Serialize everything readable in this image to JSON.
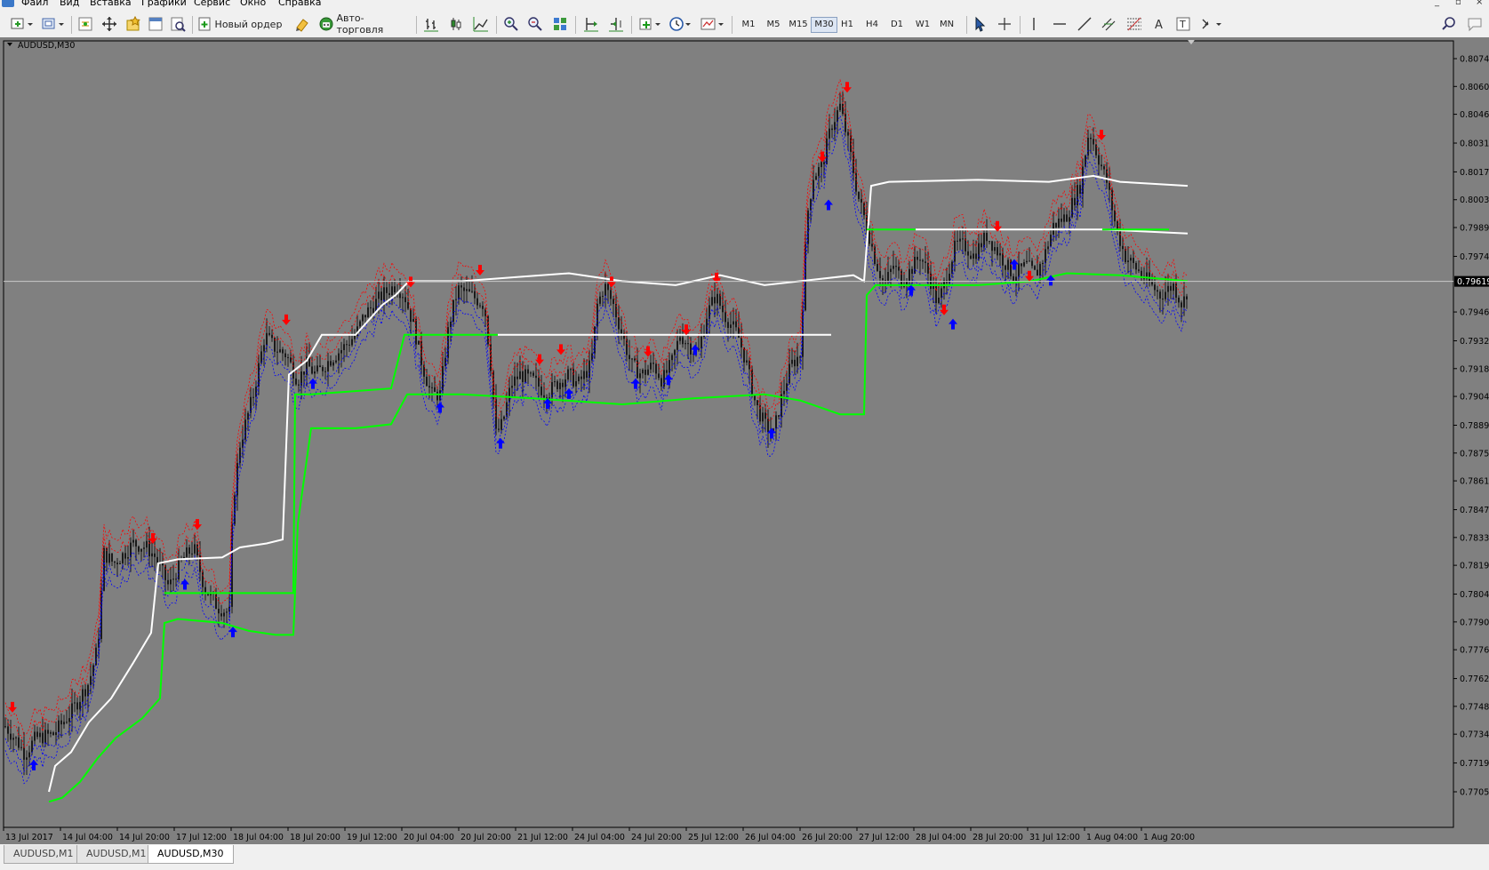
{
  "menu": [
    "Файл",
    "Вид",
    "Вставка",
    "Графики",
    "Сервис",
    "Окно",
    "Справка"
  ],
  "toolbar": {
    "new_order_label": "Новый ордер",
    "auto_trading_label": "Авто-торговля",
    "timeframes": [
      "M1",
      "M5",
      "M15",
      "M30",
      "H1",
      "H4",
      "D1",
      "W1",
      "MN"
    ],
    "active_timeframe": "M30"
  },
  "chart": {
    "symbol_label": "AUDUSD,M30",
    "current_price_label": "0.79619",
    "price_axis_labels": [
      "0.80740",
      "0.80600",
      "0.80460",
      "0.80315",
      "0.80170",
      "0.80030",
      "0.79890",
      "0.79745",
      "0.79465",
      "0.79320",
      "0.79180",
      "0.79040",
      "0.78895",
      "0.78755",
      "0.78615",
      "0.78470",
      "0.78330",
      "0.78190",
      "0.78045",
      "0.77905",
      "0.77765",
      "0.77620",
      "0.77480",
      "0.77340",
      "0.77195",
      "0.77050"
    ],
    "time_axis_labels": [
      "13 Jul 2017",
      "14 Jul 04:00",
      "14 Jul 20:00",
      "17 Jul 12:00",
      "18 Jul 04:00",
      "18 Jul 20:00",
      "19 Jul 12:00",
      "20 Jul 04:00",
      "20 Jul 20:00",
      "21 Jul 12:00",
      "24 Jul 04:00",
      "24 Jul 20:00",
      "25 Jul 12:00",
      "26 Jul 04:00",
      "26 Jul 20:00",
      "27 Jul 12:00",
      "28 Jul 04:00",
      "28 Jul 20:00",
      "31 Jul 12:00",
      "1 Aug 04:00",
      "1 Aug 20:00"
    ],
    "colors": {
      "background": "#808080",
      "candles": "#1a1a1a",
      "white_line": "#ffffff",
      "green_line": "#00ff00",
      "red_band": "#ff0000",
      "blue_band": "#0000ff",
      "arrow_down": "#ff0000",
      "arrow_up": "#0000ff",
      "price_line": "#c8c8c8"
    }
  },
  "tabs": [
    "AUDUSD,M1",
    "AUDUSD,M1",
    "AUDUSD,M30"
  ],
  "active_tab_index": 2
}
